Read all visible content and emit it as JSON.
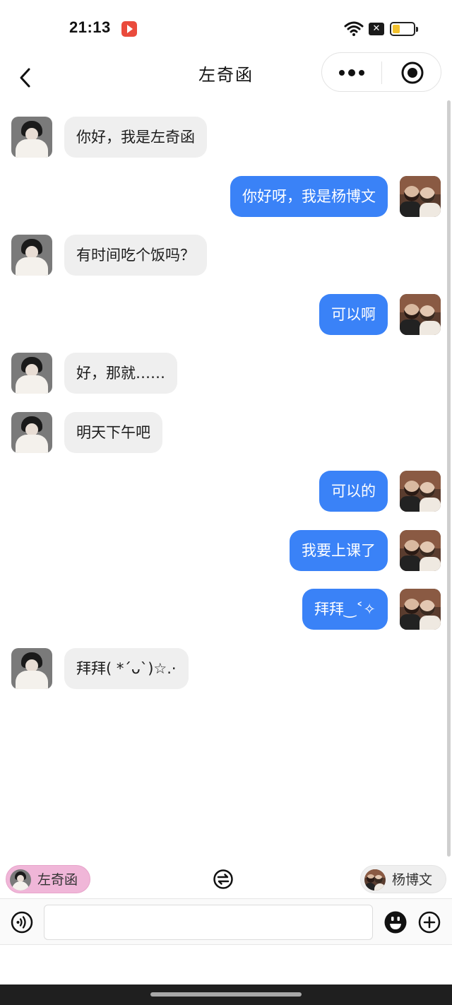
{
  "status_bar": {
    "time": "21:13",
    "x_label": "✕"
  },
  "nav": {
    "title": "左奇函"
  },
  "messages": [
    {
      "side": "left",
      "sender": "左奇函",
      "text": "你好，我是左奇函"
    },
    {
      "side": "right",
      "sender": "杨博文",
      "text": "你好呀，我是杨博文"
    },
    {
      "side": "left",
      "sender": "左奇函",
      "text": "有时间吃个饭吗？"
    },
    {
      "side": "right",
      "sender": "杨博文",
      "text": "可以啊"
    },
    {
      "side": "left",
      "sender": "左奇函",
      "text": "好，那就……"
    },
    {
      "side": "left",
      "sender": "左奇函",
      "text": "明天下午吧"
    },
    {
      "side": "right",
      "sender": "杨博文",
      "text": "可以的"
    },
    {
      "side": "right",
      "sender": "杨博文",
      "text": "我要上课了"
    },
    {
      "side": "right",
      "sender": "杨博文",
      "text": "拜拜‿˂✧"
    },
    {
      "side": "left",
      "sender": "左奇函",
      "text": "拜拜( *´ᴗ`)☆.·"
    }
  ],
  "switch_bar": {
    "left_sender": "左奇函",
    "right_sender": "杨博文",
    "active": "左奇函"
  },
  "input": {
    "value": "",
    "placeholder": ""
  },
  "colors": {
    "bubble_self": "#3a82f7",
    "bubble_other": "#efefef",
    "active_sender_chip": "#f0b6d8"
  }
}
